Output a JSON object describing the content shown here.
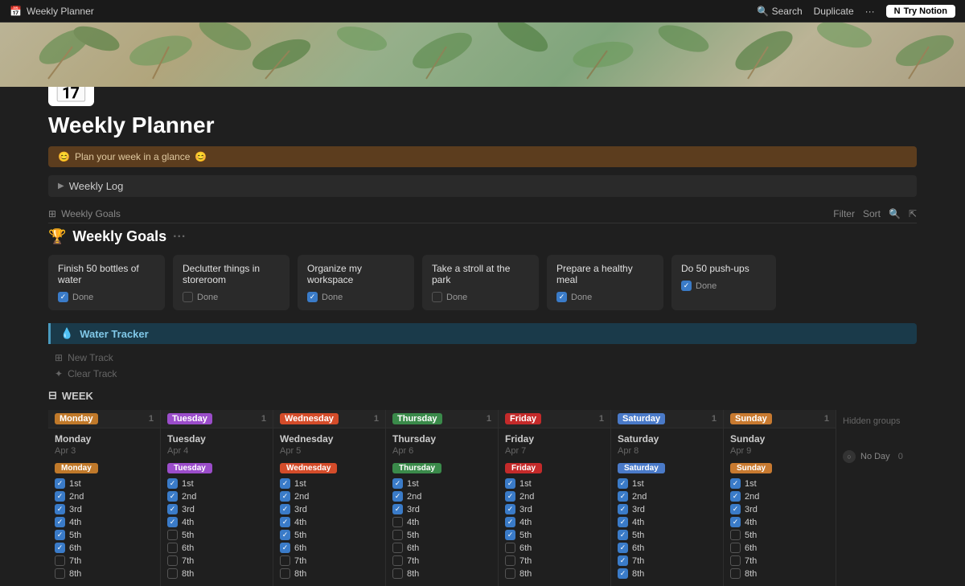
{
  "topbar": {
    "title": "Weekly Planner",
    "search_label": "Search",
    "duplicate_label": "Duplicate",
    "more_label": "···",
    "try_notion_label": "Try Notion"
  },
  "callout": {
    "text": "Plan your week in a glance"
  },
  "weekly_log": {
    "label": "Weekly Log"
  },
  "goals_section": {
    "header_label": "Weekly Goals",
    "filter_label": "Filter",
    "sort_label": "Sort",
    "title": "Weekly Goals",
    "dots": "···",
    "cards": [
      {
        "title": "Finish 50 bottles of water",
        "done": true
      },
      {
        "title": "Declutter things in storeroom",
        "done": false
      },
      {
        "title": "Organize my workspace",
        "done": true
      },
      {
        "title": "Take a stroll at the park",
        "done": false
      },
      {
        "title": "Prepare a healthy meal",
        "done": true
      },
      {
        "title": "Do 50 push-ups",
        "done": true
      }
    ]
  },
  "water_tracker": {
    "label": "Water Tracker",
    "new_track": "New Track",
    "clear_track": "Clear Track"
  },
  "week_section": {
    "label": "WEEK"
  },
  "days": [
    {
      "tag": "Monday",
      "tag_color": "#c0792a",
      "count": 1,
      "name": "Monday",
      "date": "Apr 3",
      "pill": "Monday",
      "pill_color": "#c0792a",
      "tasks": [
        {
          "label": "1st",
          "checked": true
        },
        {
          "label": "2nd",
          "checked": true
        },
        {
          "label": "3rd",
          "checked": true
        },
        {
          "label": "4th",
          "checked": true
        },
        {
          "label": "5th",
          "checked": true
        },
        {
          "label": "6th",
          "checked": true
        },
        {
          "label": "7th",
          "checked": false
        },
        {
          "label": "8th",
          "checked": false
        }
      ]
    },
    {
      "tag": "Tuesday",
      "tag_color": "#9b4dca",
      "count": 1,
      "name": "Tuesday",
      "date": "Apr 4",
      "pill": "Tuesday",
      "pill_color": "#9b4dca",
      "tasks": [
        {
          "label": "1st",
          "checked": true
        },
        {
          "label": "2nd",
          "checked": true
        },
        {
          "label": "3rd",
          "checked": true
        },
        {
          "label": "4th",
          "checked": true
        },
        {
          "label": "5th",
          "checked": false
        },
        {
          "label": "6th",
          "checked": false
        },
        {
          "label": "7th",
          "checked": false
        },
        {
          "label": "8th",
          "checked": false
        }
      ]
    },
    {
      "tag": "Wednesday",
      "tag_color": "#d44c2a",
      "count": 1,
      "name": "Wednesday",
      "date": "Apr 5",
      "pill": "Wednesday",
      "pill_color": "#d44c2a",
      "tasks": [
        {
          "label": "1st",
          "checked": true
        },
        {
          "label": "2nd",
          "checked": true
        },
        {
          "label": "3rd",
          "checked": true
        },
        {
          "label": "4th",
          "checked": true
        },
        {
          "label": "5th",
          "checked": true
        },
        {
          "label": "6th",
          "checked": true
        },
        {
          "label": "7th",
          "checked": false
        },
        {
          "label": "8th",
          "checked": false
        }
      ]
    },
    {
      "tag": "Thursday",
      "tag_color": "#3a8a4a",
      "count": 1,
      "name": "Thursday",
      "date": "Apr 6",
      "pill": "Thursday",
      "pill_color": "#3a8a4a",
      "tasks": [
        {
          "label": "1st",
          "checked": true
        },
        {
          "label": "2nd",
          "checked": true
        },
        {
          "label": "3rd",
          "checked": true
        },
        {
          "label": "4th",
          "checked": false
        },
        {
          "label": "5th",
          "checked": false
        },
        {
          "label": "6th",
          "checked": false
        },
        {
          "label": "7th",
          "checked": false
        },
        {
          "label": "8th",
          "checked": false
        }
      ]
    },
    {
      "tag": "Friday",
      "tag_color": "#c42a2a",
      "count": 1,
      "name": "Friday",
      "date": "Apr 7",
      "pill": "Friday",
      "pill_color": "#c42a2a",
      "tasks": [
        {
          "label": "1st",
          "checked": true
        },
        {
          "label": "2nd",
          "checked": true
        },
        {
          "label": "3rd",
          "checked": true
        },
        {
          "label": "4th",
          "checked": true
        },
        {
          "label": "5th",
          "checked": true
        },
        {
          "label": "6th",
          "checked": false
        },
        {
          "label": "7th",
          "checked": false
        },
        {
          "label": "8th",
          "checked": false
        }
      ]
    },
    {
      "tag": "Saturday",
      "tag_color": "#4a7ac8",
      "count": 1,
      "name": "Saturday",
      "date": "Apr 8",
      "pill": "Saturday",
      "pill_color": "#4a7ac8",
      "tasks": [
        {
          "label": "1st",
          "checked": true
        },
        {
          "label": "2nd",
          "checked": true
        },
        {
          "label": "3rd",
          "checked": true
        },
        {
          "label": "4th",
          "checked": true
        },
        {
          "label": "5th",
          "checked": true
        },
        {
          "label": "6th",
          "checked": true
        },
        {
          "label": "7th",
          "checked": true
        },
        {
          "label": "8th",
          "checked": true
        }
      ]
    },
    {
      "tag": "Sunday",
      "tag_color": "#c87a30",
      "count": 1,
      "name": "Sunday",
      "date": "Apr 9",
      "pill": "Sunday",
      "pill_color": "#c87a30",
      "tasks": [
        {
          "label": "1st",
          "checked": true
        },
        {
          "label": "2nd",
          "checked": true
        },
        {
          "label": "3rd",
          "checked": true
        },
        {
          "label": "4th",
          "checked": true
        },
        {
          "label": "5th",
          "checked": false
        },
        {
          "label": "6th",
          "checked": false
        },
        {
          "label": "7th",
          "checked": false
        },
        {
          "label": "8th",
          "checked": false
        }
      ]
    }
  ],
  "hidden_groups": {
    "label": "Hidden groups",
    "no_day_label": "No Day",
    "no_day_count": 0
  }
}
